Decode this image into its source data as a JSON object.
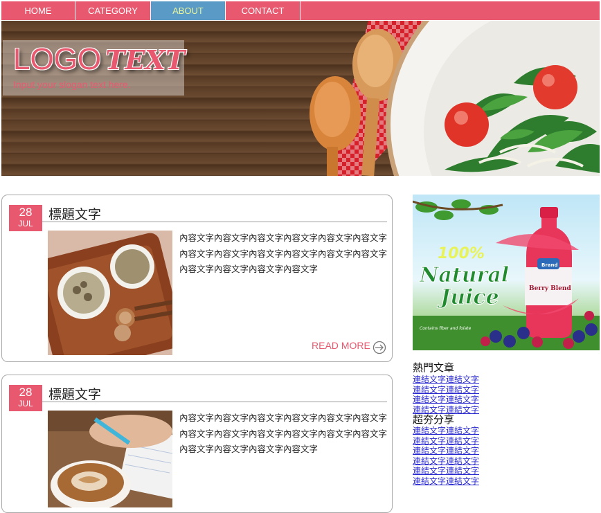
{
  "nav": {
    "items": [
      {
        "label": "HOME"
      },
      {
        "label": "CATEGORY"
      },
      {
        "label": "ABOUT"
      },
      {
        "label": "CONTACT"
      }
    ],
    "active_index": 2
  },
  "brand": {
    "logo_main": "LOGO",
    "logo_accent": "TEXT",
    "slogan": "Input your slogan text here.",
    "accent_color": "#e8596f"
  },
  "posts": [
    {
      "day": "28",
      "month": "JUL",
      "title": "標題文字",
      "body": "內容文字內容文字內容文字內容文字內容文字內容文字內容文字內容文字內容文字內容文字內容文字內容文字內容文字內容文字內容文字內容文字",
      "read_more": "READ MORE"
    },
    {
      "day": "28",
      "month": "JUL",
      "title": "標題文字",
      "body": "內容文字內容文字內容文字內容文字內容文字內容文字內容文字內容文字內容文字內容文字內容文字內容文字內容文字內容文字內容文字內容文字"
    }
  ],
  "ad": {
    "line1": "100%",
    "line2": "Natural",
    "line3": "Juice",
    "brand": "Brand",
    "product": "Berry Blend",
    "tagline": "Contains fiber and folate"
  },
  "sidebar": {
    "hot_title": "熱門文章",
    "hot_links": [
      "連結文字連結文字",
      "連結文字連結文字",
      "連結文字連結文字",
      "連結文字連結文字"
    ],
    "share_title": "超夯分享",
    "share_links": [
      "連結文字連結文字",
      "連結文字連結文字",
      "連結文字連結文字",
      "連結文字連結文字",
      "連結文字連結文字",
      "連結文字連結文字"
    ]
  }
}
